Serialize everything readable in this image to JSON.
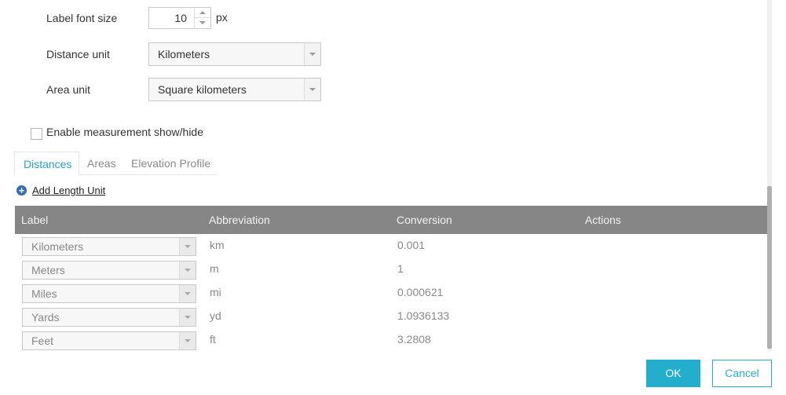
{
  "settings": {
    "label_font_size": {
      "label": "Label font size",
      "value": "10",
      "unit": "px"
    },
    "distance_unit": {
      "label": "Distance unit",
      "value": "Kilometers"
    },
    "area_unit": {
      "label": "Area unit",
      "value": "Square kilometers"
    },
    "enable_toggle": {
      "label": "Enable measurement show/hide",
      "checked": false
    }
  },
  "tabs": [
    {
      "label": "Distances",
      "active": true
    },
    {
      "label": "Areas",
      "active": false
    },
    {
      "label": "Elevation Profile",
      "active": false
    }
  ],
  "add_link": {
    "label": "Add Length Unit",
    "icon": "plus-circle-icon"
  },
  "table": {
    "headers": [
      "Label",
      "Abbreviation",
      "Conversion",
      "Actions"
    ],
    "rows": [
      {
        "label": "Kilometers",
        "abbreviation": "km",
        "conversion": "0.001"
      },
      {
        "label": "Meters",
        "abbreviation": "m",
        "conversion": "1"
      },
      {
        "label": "Miles",
        "abbreviation": "mi",
        "conversion": "0.000621"
      },
      {
        "label": "Yards",
        "abbreviation": "yd",
        "conversion": "1.0936133"
      },
      {
        "label": "Feet",
        "abbreviation": "ft",
        "conversion": "3.2808"
      }
    ]
  },
  "footer": {
    "ok_label": "OK",
    "cancel_label": "Cancel"
  },
  "colors": {
    "accent": "#23aecd",
    "header_bg": "#868686"
  }
}
